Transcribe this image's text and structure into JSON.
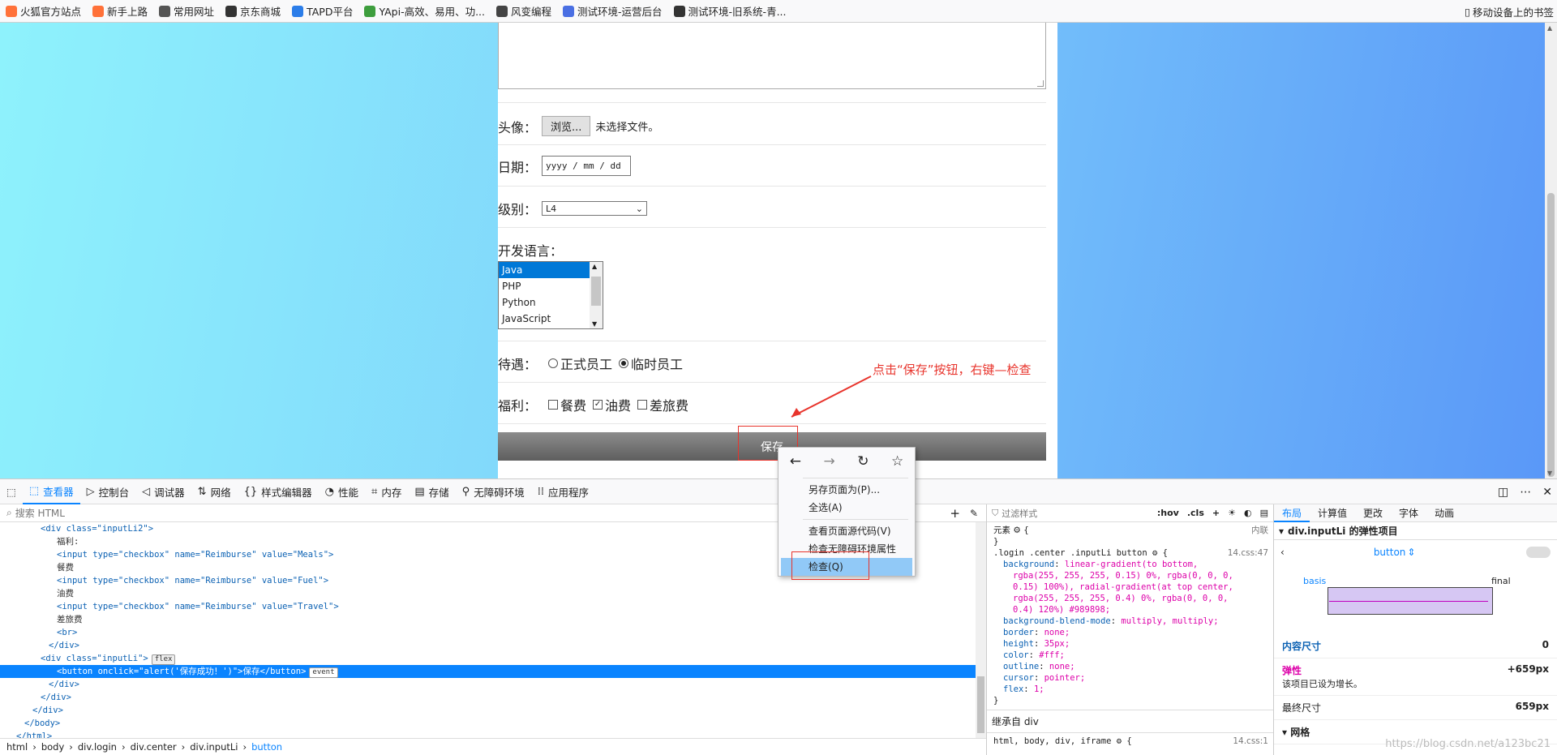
{
  "bookmarks": {
    "items": [
      {
        "label": "火狐官方站点",
        "color": "#ff7139"
      },
      {
        "label": "新手上路",
        "color": "#ff7139"
      },
      {
        "label": "常用网址",
        "color": "#555555"
      },
      {
        "label": "京东商城",
        "color": "#333333"
      },
      {
        "label": "TAPD平台",
        "color": "#2b7de9"
      },
      {
        "label": "YApi-高效、易用、功...",
        "color": "#3e9e3e"
      },
      {
        "label": "风变编程",
        "color": "#444444"
      },
      {
        "label": "测试环境-运营后台",
        "color": "#4a6fe3"
      },
      {
        "label": "测试环境-旧系统-青...",
        "color": "#333333"
      }
    ],
    "mobile_label": "移动设备上的书签"
  },
  "form": {
    "avatar_label": "头像：",
    "browse_button": "浏览...",
    "no_file": "未选择文件。",
    "date_label": "日期：",
    "date_placeholder": "yyyy / mm / dd",
    "level_label": "级别：",
    "level_value": "L4",
    "lang_label": "开发语言：",
    "languages": [
      "Java",
      "PHP",
      "Python",
      "JavaScript"
    ],
    "selected_language": "Java",
    "treatment_label": "待遇：",
    "treatment_options": [
      "正式员工",
      "临时员工"
    ],
    "treatment_selected": "临时员工",
    "benefit_label": "福利：",
    "benefits": [
      "餐费",
      "油费",
      "差旅费"
    ],
    "benefits_checked": [
      "油费"
    ],
    "save_button": "保存"
  },
  "annotation": {
    "text": "点击“保存”按钮，右键—检查",
    "color": "#e8342c"
  },
  "context_menu": {
    "items": [
      "另存页面为(P)...",
      "全选(A)",
      "查看页面源代码(V)",
      "检查无障碍环境属性",
      "检查(Q)"
    ],
    "highlighted": "检查(Q)"
  },
  "devtools": {
    "tabs": [
      "查看器",
      "控制台",
      "调试器",
      "网络",
      "样式编辑器",
      "性能",
      "内存",
      "存储",
      "无障碍环境",
      "应用程序"
    ],
    "active_tab": "查看器",
    "search_placeholder": "搜索 HTML",
    "code_lines": [
      {
        "html": "<div class=\"inputLi2\">",
        "indent": 5,
        "tag": true
      },
      {
        "html": "福利:",
        "indent": 7,
        "tag": false
      },
      {
        "html": "<input type=\"checkbox\" name=\"Reimburse\" value=\"Meals\">",
        "indent": 7,
        "tag": true
      },
      {
        "html": "餐费",
        "indent": 7,
        "tag": false
      },
      {
        "html": "<input type=\"checkbox\" name=\"Reimburse\" value=\"Fuel\">",
        "indent": 7,
        "tag": true
      },
      {
        "html": "油费",
        "indent": 7,
        "tag": false
      },
      {
        "html": "<input type=\"checkbox\" name=\"Reimburse\" value=\"Travel\">",
        "indent": 7,
        "tag": true
      },
      {
        "html": "差旅费",
        "indent": 7,
        "tag": false
      },
      {
        "html": "<br>",
        "indent": 7,
        "tag": true
      },
      {
        "html": "</div>",
        "indent": 6,
        "tag": true
      },
      {
        "html": "<div class=\"inputLi\">",
        "indent": 5,
        "tag": true,
        "badge": "flex"
      },
      {
        "html": "<button onclick=\"alert('保存成功！')\">保存</button>",
        "indent": 7,
        "tag": true,
        "badge": "event",
        "selected": true
      },
      {
        "html": "</div>",
        "indent": 6,
        "tag": true
      },
      {
        "html": "</div>",
        "indent": 5,
        "tag": true
      },
      {
        "html": "</div>",
        "indent": 4,
        "tag": true
      },
      {
        "html": "</body>",
        "indent": 3,
        "tag": true
      },
      {
        "html": "</html>",
        "indent": 2,
        "tag": true
      }
    ],
    "breadcrumbs": [
      "html",
      "body",
      "div.login",
      "div.center",
      "div.inputLi",
      "button"
    ]
  },
  "rules": {
    "filter_placeholder": "过滤样式",
    "toolbar": [
      ":hov",
      ".cls"
    ],
    "element_label": "元素",
    "inline_label": "内联",
    "selector": ".login .center .inputLi button",
    "source": "14.css:47",
    "declarations": [
      [
        "background",
        "linear-gradient(to bottom,"
      ],
      [
        "",
        "rgba(255, 255, 255, 0.15) 0%,  rgba(0, 0, 0,"
      ],
      [
        "",
        "0.15) 100%), radial-gradient(at top center,"
      ],
      [
        "",
        "rgba(255, 255, 255, 0.4) 0%,  rgba(0, 0, 0,"
      ],
      [
        "",
        "0.4) 120%)  #989898;"
      ],
      [
        "background-blend-mode",
        "multiply, multiply;"
      ],
      [
        "border",
        "none;"
      ],
      [
        "height",
        "35px;"
      ],
      [
        "color",
        "#fff;"
      ],
      [
        "outline",
        "none;"
      ],
      [
        "cursor",
        "pointer;"
      ],
      [
        "flex",
        "1;"
      ]
    ],
    "inherited_label": "继承自 div",
    "inherited_selector": "html, body, div, iframe",
    "inherited_source": "14.css:1"
  },
  "layout": {
    "tabs": [
      "布局",
      "计算值",
      "更改",
      "字体",
      "动画"
    ],
    "active_tab": "布局",
    "flex_item_title": "div.inputLi 的弹性项目",
    "item_select": "button",
    "basis_label": "basis",
    "final_label": "final",
    "content_size_label": "内容尺寸",
    "content_size_value": "0",
    "flex_label": "弹性",
    "flex_value": "+659px",
    "flex_note": "该项目已设为增长。",
    "final_size_label": "最终尺寸",
    "final_size_value": "659px",
    "grid_label": "网格"
  },
  "watermark": "https://blog.csdn.net/a123bc21"
}
